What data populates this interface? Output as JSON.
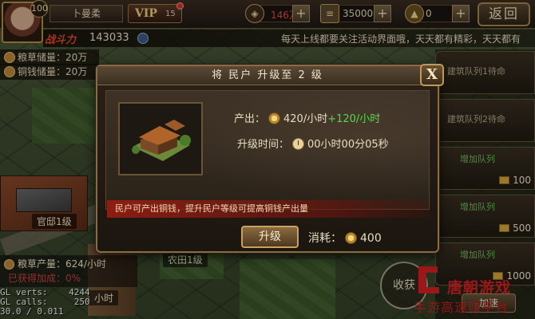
{
  "topbar": {
    "avatar_level": "100",
    "player_name": "卜曼柔",
    "vip_label": "VIP",
    "vip_level": "15",
    "gold": "146万",
    "gold_plus": "+",
    "scroll": "35000",
    "scroll_plus": "+",
    "ingot": "0",
    "ingot_plus": "+",
    "back": "返回"
  },
  "power": {
    "label": "战斗力",
    "value": "143033",
    "marquee": "每天上线都要关注活动界面哦，天天都有精彩，天天都有"
  },
  "stock": {
    "grain": "粮草储量：20万",
    "copper": "铜钱储量：20万"
  },
  "map": {
    "labels": [
      "官邸1级",
      "农田1级",
      "小时"
    ]
  },
  "queue": {
    "items": [
      {
        "label": "建筑队列1待命"
      },
      {
        "label": "建筑队列2待命"
      },
      {
        "add": "增加队列",
        "cost": "100"
      },
      {
        "add": "增加队列",
        "cost": "500"
      },
      {
        "add": "增加队列",
        "cost": "1000"
      }
    ],
    "speed_up": "加速"
  },
  "production": {
    "line1": "粮草产量：624/小时",
    "line2": "已获得加成：0%"
  },
  "debug": {
    "text": "GL verts:    4244\nGL calls:     250\n30.0 / 0.011"
  },
  "watermark": {
    "seal": "收获",
    "brand": "唐朝游戏",
    "slogan": "手游高速赚平台"
  },
  "modal": {
    "title": "将 民户  升级至 2 级",
    "close": "X",
    "output_label": "产出：",
    "output_base": "420/小时",
    "output_bonus": "+120/小时",
    "time_label": "升级时间：",
    "time_value": "00小时00分05秒",
    "tip": "民户可产出铜钱，提升民户等级可提高铜钱产出量",
    "upgrade_button": "升级",
    "cost_label": "消耗：",
    "cost_value": "400"
  },
  "colors": {
    "accent_gold": "#c8a050",
    "bonus_green": "#52d84a",
    "warning_red": "#d82020"
  }
}
